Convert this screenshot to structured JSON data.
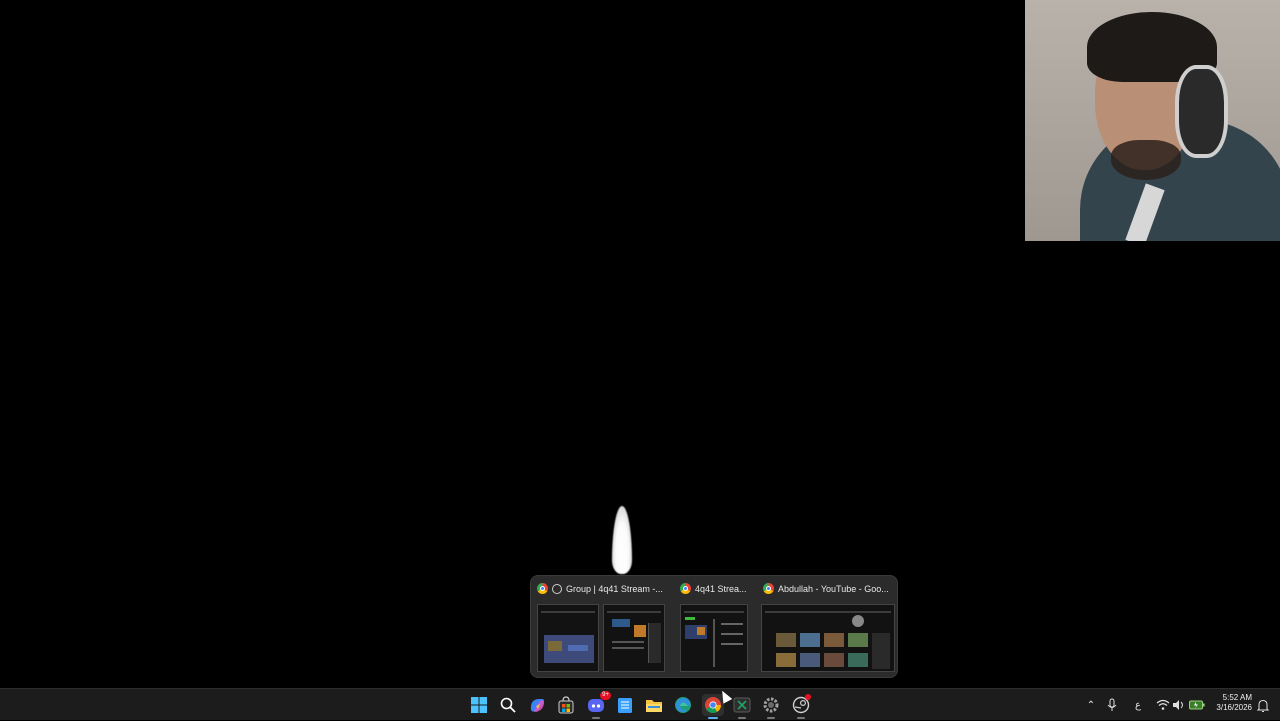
{
  "preview": {
    "items": [
      {
        "title": "Group | 4q41 Stream -..."
      },
      {
        "title": "4q41 Strea..."
      },
      {
        "title": "Abdullah - YouTube - Goo..."
      }
    ]
  },
  "taskbar": {
    "apps": [
      {
        "name": "windows-start-icon"
      },
      {
        "name": "search-icon"
      },
      {
        "name": "copilot-icon"
      },
      {
        "name": "microsoft-store-icon"
      },
      {
        "name": "discord-icon",
        "badge": "9+"
      },
      {
        "name": "notepad-icon"
      },
      {
        "name": "file-explorer-icon"
      },
      {
        "name": "edge-icon"
      },
      {
        "name": "chrome-icon",
        "active": true
      },
      {
        "name": "excel-icon"
      },
      {
        "name": "settings-icon"
      },
      {
        "name": "steam-icon",
        "badge_dot": true
      }
    ],
    "tray": {
      "input_indicator": "ع",
      "time": "5:52 AM",
      "date": "3/16/2026"
    }
  },
  "colors": {
    "taskbar_bg": "#1c1c1c",
    "preview_bg": "#2b2b2b",
    "active_indicator": "#5fb2f2",
    "notification_red": "#e81123"
  }
}
